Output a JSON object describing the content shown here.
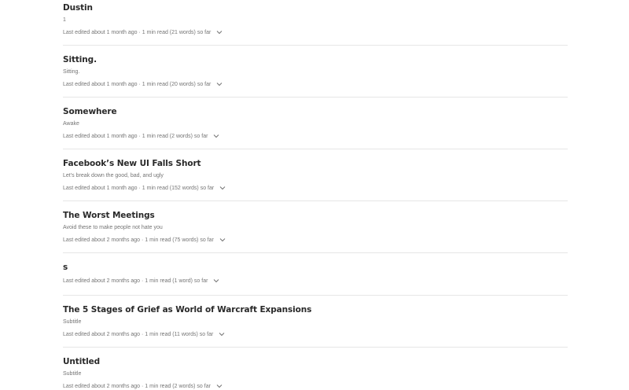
{
  "stories": [
    {
      "title": "Dustin",
      "subtitle": "1",
      "meta": "Last edited about 1 month ago · 1 min read (21 words) so far"
    },
    {
      "title": "Sitting.",
      "subtitle": "Sitting.",
      "meta": "Last edited about 1 month ago · 1 min read (20 words) so far"
    },
    {
      "title": "Somewhere",
      "subtitle": "Awake",
      "meta": "Last edited about 1 month ago · 1 min read (2 words) so far"
    },
    {
      "title": "Facebook’s New UI Falls Short",
      "subtitle": "Let’s break down the good, bad, and ugly",
      "meta": "Last edited about 1 month ago · 1 min read (152 words) so far"
    },
    {
      "title": "The Worst Meetings",
      "subtitle": "Avoid these to make people not hate you",
      "meta": "Last edited about 2 months ago · 1 min read (75 words) so far"
    },
    {
      "title": "s",
      "subtitle": "",
      "meta": "Last edited about 2 months ago · 1 min read (1 word) so far"
    },
    {
      "title": "The 5 Stages of Grief as World of Warcraft Expansions",
      "subtitle": "Subtitle",
      "meta": "Last edited about 2 months ago · 1 min read (11 words) so far"
    },
    {
      "title": "Untitled",
      "subtitle": "Subtitle",
      "meta": "Last edited about 2 months ago · 1 min read (2 words) so far"
    }
  ],
  "icons": {
    "more": "chevron-down-icon"
  },
  "colors": {
    "title": "#292929",
    "meta": "#757575",
    "divider": "#e6e6e6"
  }
}
